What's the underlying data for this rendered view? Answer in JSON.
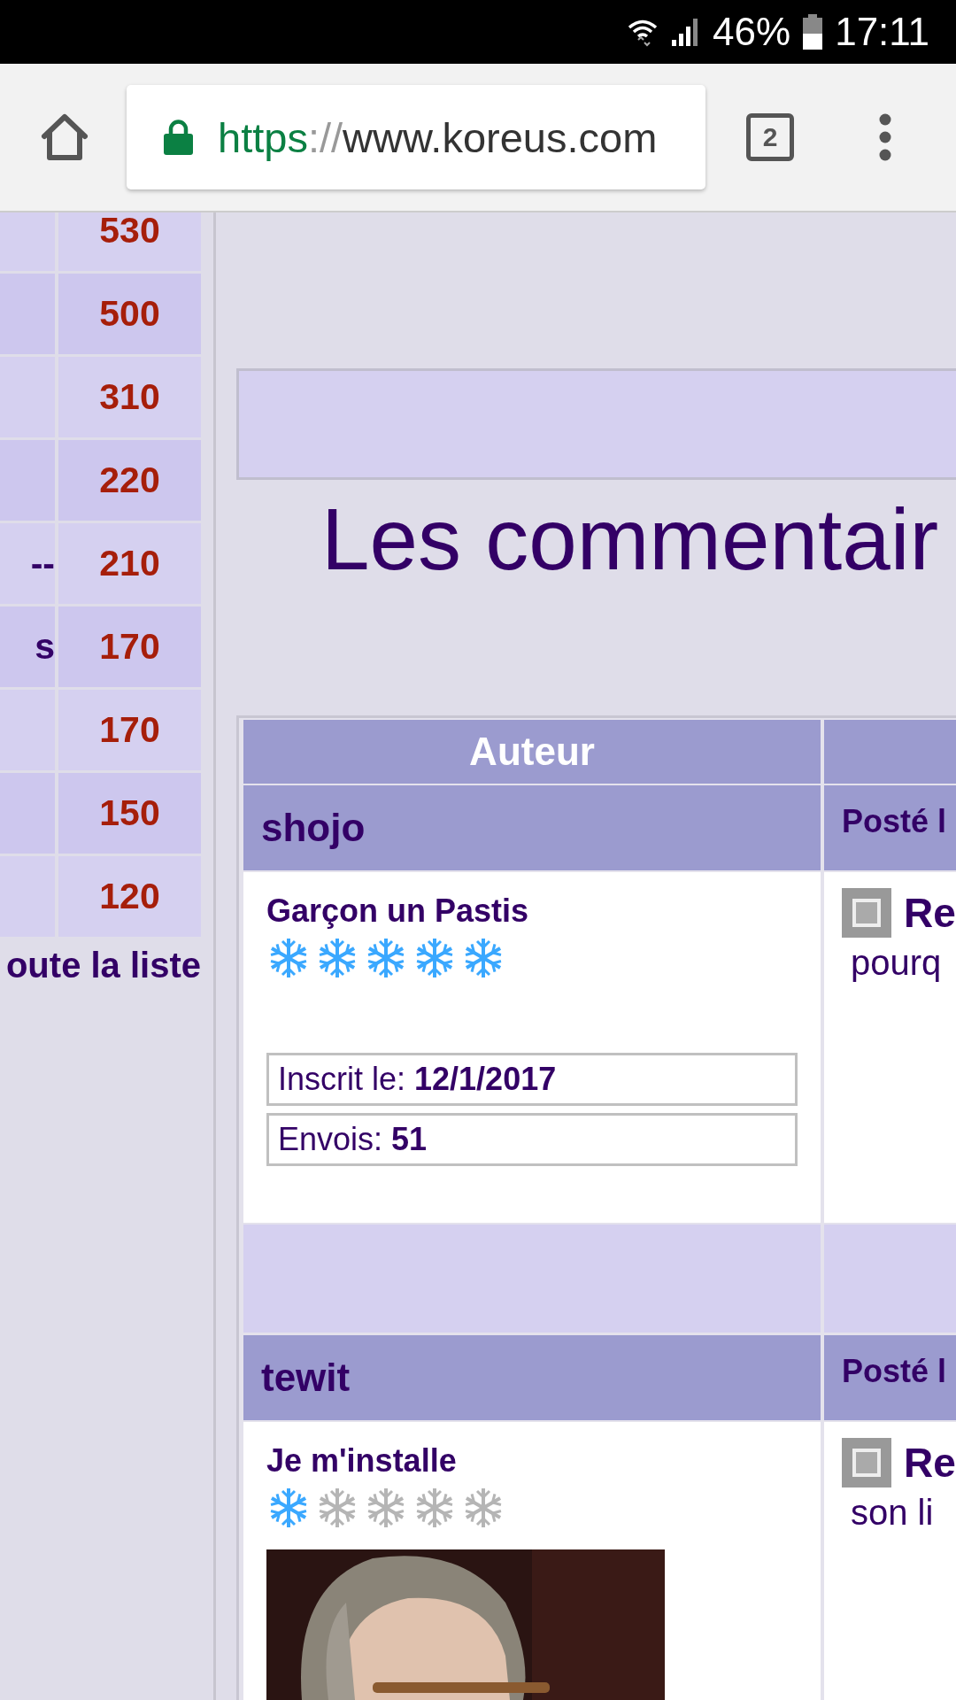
{
  "status_bar": {
    "battery": "46%",
    "time": "17:11"
  },
  "browser": {
    "url": {
      "scheme": "https",
      "separator": "://",
      "host": "www.koreus.com"
    },
    "tab_count": "2"
  },
  "sidebar": {
    "rows": [
      {
        "score": "530"
      },
      {
        "score": "500"
      },
      {
        "score": "310"
      },
      {
        "score": "220"
      },
      {
        "label": "--",
        "score": "210"
      },
      {
        "label": "s",
        "score": "170"
      },
      {
        "score": "170"
      },
      {
        "score": "150"
      },
      {
        "score": "120"
      }
    ],
    "link": "oute la liste"
  },
  "heading": "Les commentair",
  "table": {
    "columns": [
      "Auteur"
    ],
    "posts": [
      {
        "author": "shojo",
        "rank": "Garçon un Pastis",
        "stars": 5,
        "details": [
          {
            "label": "Inscrit le:",
            "value": "12/1/2017"
          },
          {
            "label": "Envois:",
            "value": "51"
          }
        ],
        "posted_label": "Posté l",
        "title": "Re",
        "text": "pourq"
      },
      {
        "author": "tewit",
        "rank": "Je m'installe",
        "stars": 1,
        "posted_label": "Posté l",
        "title": "Re",
        "text": "son li"
      }
    ]
  }
}
